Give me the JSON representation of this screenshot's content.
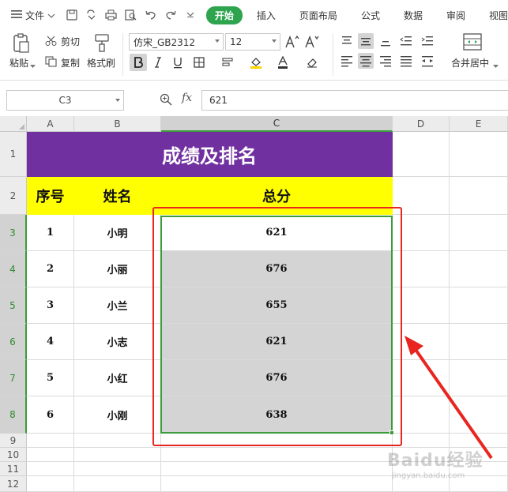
{
  "menu": {
    "file_label": "文件",
    "tabs": [
      {
        "label": "开始",
        "active": true
      },
      {
        "label": "插入",
        "active": false
      },
      {
        "label": "页面布局",
        "active": false
      },
      {
        "label": "公式",
        "active": false
      },
      {
        "label": "数据",
        "active": false
      },
      {
        "label": "审阅",
        "active": false
      },
      {
        "label": "视图",
        "active": false
      }
    ]
  },
  "ribbon": {
    "paste_label": "粘贴",
    "cut_label": "剪切",
    "copy_label": "复制",
    "format_painter_label": "格式刷",
    "font_name": "仿宋_GB2312",
    "font_size": "12",
    "merge_center_label": "合并居中"
  },
  "formula_bar": {
    "name_box": "C3",
    "fx_label": "fx",
    "formula": "621"
  },
  "sheet": {
    "columns": [
      "A",
      "B",
      "C",
      "D",
      "E"
    ],
    "rows": [
      "1",
      "2",
      "3",
      "4",
      "5",
      "6",
      "7",
      "8",
      "9",
      "10",
      "11",
      "12"
    ],
    "title": "成绩及排名",
    "headers": [
      "序号",
      "姓名",
      "总分"
    ],
    "data": [
      {
        "no": "1",
        "name": "小明",
        "score": "621"
      },
      {
        "no": "2",
        "name": "小丽",
        "score": "676"
      },
      {
        "no": "3",
        "name": "小兰",
        "score": "655"
      },
      {
        "no": "4",
        "name": "小志",
        "score": "621"
      },
      {
        "no": "5",
        "name": "小红",
        "score": "676"
      },
      {
        "no": "6",
        "name": "小刚",
        "score": "638"
      }
    ],
    "selected_column": "C",
    "selected_cell": "C3"
  },
  "colors": {
    "accent": "#2ea44f",
    "title_fill": "#7030a0",
    "header_fill": "#ffff00",
    "selection": "#3b9a3b",
    "annotation": "#e8251f"
  },
  "watermark": {
    "text": "Baidu经验",
    "sub": "jingyan.baidu.com"
  }
}
